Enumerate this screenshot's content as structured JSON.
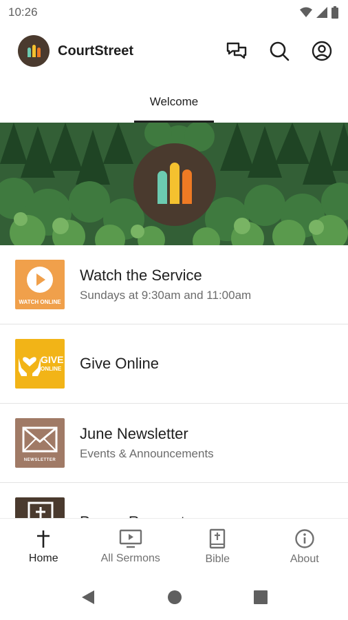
{
  "status_bar": {
    "time": "10:26"
  },
  "app_bar": {
    "title": "CourtStreet"
  },
  "tabs": [
    {
      "label": "Welcome",
      "active": true
    }
  ],
  "feed": [
    {
      "title": "Watch the Service",
      "subtitle": "Sundays at 9:30am and 11:00am",
      "thumb_caption": "WATCH ONLINE",
      "thumb_color": "#f0a04b",
      "icon": "play-icon"
    },
    {
      "title": "Give Online",
      "subtitle": "",
      "thumb_caption_line1": "GIVE",
      "thumb_caption_line2": "ONLINE",
      "thumb_color": "#f2b417",
      "icon": "heart-hands-icon"
    },
    {
      "title": "June Newsletter",
      "subtitle": "Events & Announcements",
      "thumb_caption": "NEWSLETTER",
      "thumb_color": "#a07a66",
      "icon": "envelope-icon"
    },
    {
      "title": "Prayer Requests",
      "subtitle": "",
      "thumb_color": "#4a3a2e",
      "icon": "bible-icon"
    }
  ],
  "bottom_nav": [
    {
      "label": "Home",
      "icon": "cross-icon",
      "active": true
    },
    {
      "label": "All Sermons",
      "icon": "tv-play-icon",
      "active": false
    },
    {
      "label": "Bible",
      "icon": "bible-icon",
      "active": false
    },
    {
      "label": "About",
      "icon": "info-icon",
      "active": false
    }
  ],
  "colors": {
    "brand_brown": "#4a3a2e",
    "logo_teal": "#6ccbb1",
    "logo_yellow": "#f4c12f",
    "logo_orange": "#ee7a24"
  }
}
